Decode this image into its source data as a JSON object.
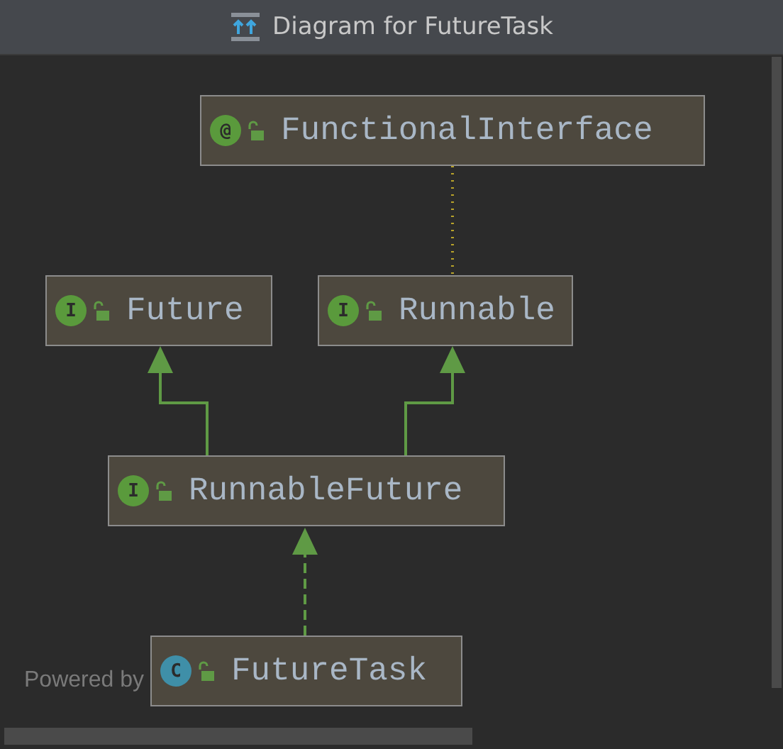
{
  "window": {
    "title": "Diagram for FutureTask"
  },
  "nodes": [
    {
      "kind": "annotation",
      "badge": "@",
      "name": "FunctionalInterface"
    },
    {
      "kind": "interface",
      "badge": "I",
      "name": "Future"
    },
    {
      "kind": "interface",
      "badge": "I",
      "name": "Runnable"
    },
    {
      "kind": "interface",
      "badge": "I",
      "name": "RunnableFuture"
    },
    {
      "kind": "class",
      "badge": "C",
      "name": "FutureTask"
    }
  ],
  "edges": [
    {
      "kind": "annotation"
    },
    {
      "kind": "extends"
    },
    {
      "kind": "extends"
    },
    {
      "kind": "implements"
    }
  ],
  "watermark_text": "Powered by"
}
